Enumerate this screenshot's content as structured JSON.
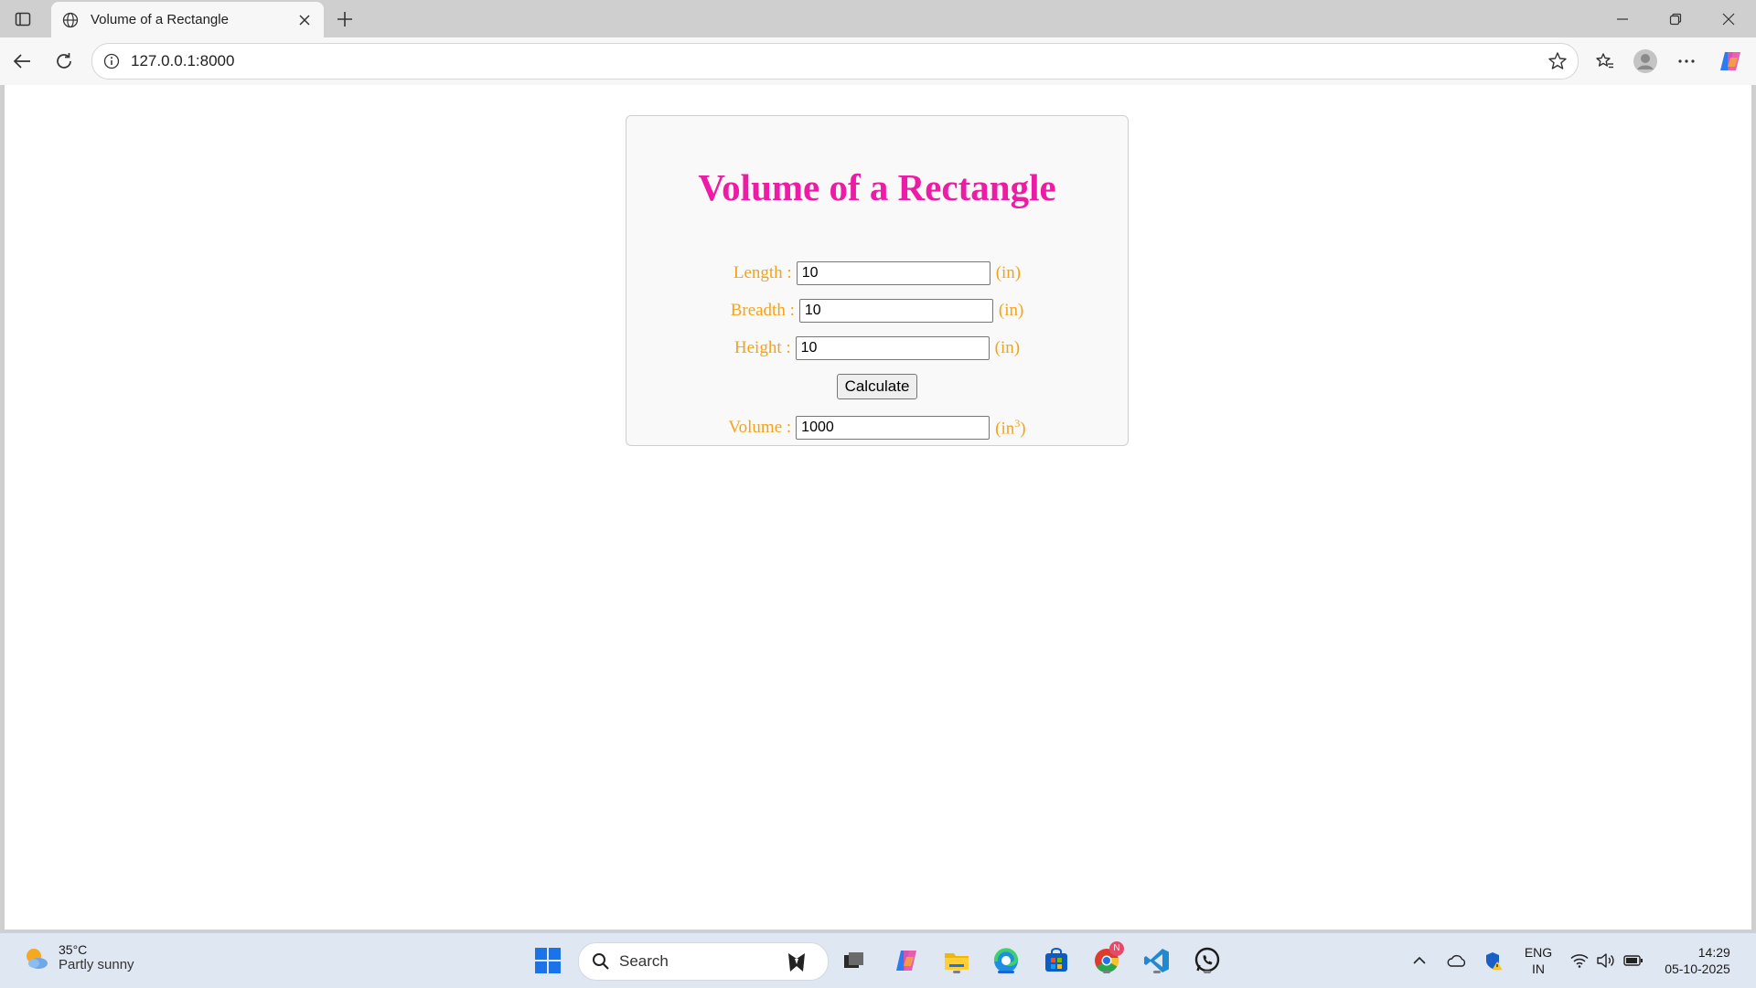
{
  "browser": {
    "tab_title": "Volume of a Rectangle",
    "url": "127.0.0.1:8000"
  },
  "page": {
    "heading": "Volume of a Rectangle",
    "fields": [
      {
        "label": "Length :",
        "value": "10",
        "unit": "(in)"
      },
      {
        "label": "Breadth :",
        "value": "10",
        "unit": "(in)"
      },
      {
        "label": "Height :",
        "value": "10",
        "unit": "(in)"
      }
    ],
    "calculate_label": "Calculate",
    "result": {
      "label": "Volume :",
      "value": "1000",
      "unit_prefix": "(in",
      "unit_sup": "3",
      "unit_suffix": ")"
    },
    "colors": {
      "heading": "#ee1ba6",
      "label": "#f4a317"
    }
  },
  "taskbar": {
    "weather_temp": "35°C",
    "weather_desc": "Partly sunny",
    "search_placeholder": "Search",
    "language_line1": "ENG",
    "language_line2": "IN",
    "time": "14:29",
    "date": "05-10-2025",
    "notification_badge": "N",
    "pinned_icons": [
      "windows-start-icon",
      "task-view-icon",
      "copilot-icon",
      "file-explorer-icon",
      "edge-icon",
      "store-icon",
      "chrome-icon",
      "vscode-icon",
      "whatsapp-icon"
    ]
  }
}
